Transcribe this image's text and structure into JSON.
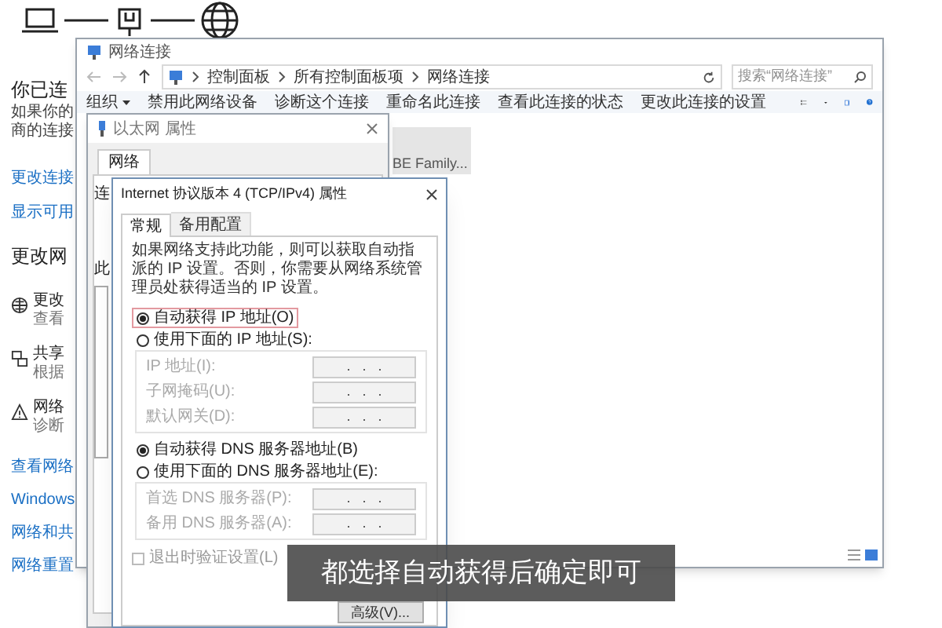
{
  "settings_page": {
    "heading": "你已连",
    "description_lines": [
      "如果你的",
      "商的连接"
    ],
    "links": [
      "更改连接",
      "显示可用"
    ],
    "section_heading": "更改网",
    "options": [
      {
        "kind": "status",
        "title": "更改",
        "subtitle": "查看"
      },
      {
        "kind": "sharing",
        "title": "共享",
        "subtitle": "根据"
      },
      {
        "kind": "troubleshoot",
        "title": "网络",
        "subtitle": "诊断"
      }
    ],
    "more_links": [
      "查看网络",
      "Windows",
      "网络和共",
      "网络重置"
    ]
  },
  "explorer_window": {
    "title": "网络连接",
    "breadcrumb": [
      "控制面板",
      "所有控制面板项",
      "网络连接"
    ],
    "search": {
      "placeholder": "搜索“网络连接”"
    },
    "organize": "组织",
    "toolbar": [
      "禁用此网络设备",
      "诊断这个连接",
      "重命名此连接",
      "查看此连接的状态",
      "更改此连接的设置"
    ],
    "adapter_label": "BE Family..."
  },
  "ethernet_properties": {
    "title": "以太网 属性",
    "tabs": [
      {
        "label": "网络",
        "selected": true
      }
    ],
    "partial_labels": [
      "连",
      "此"
    ]
  },
  "ipv4_properties": {
    "title": "Internet 协议版本 4 (TCP/IPv4) 属性",
    "tabs": [
      {
        "label": "常规",
        "selected": true
      },
      {
        "label": "备用配置",
        "selected": false
      }
    ],
    "description": "如果网络支持此功能，则可以获取自动指派的 IP 设置。否则，你需要从网络系统管理员处获得适当的 IP 设置。",
    "ip_mode": [
      {
        "label": "自动获得 IP 地址(O)",
        "selected": true,
        "highlighted": true
      },
      {
        "label": "使用下面的 IP 地址(S):",
        "selected": false,
        "highlighted": false
      }
    ],
    "ip_fields": [
      {
        "label": "IP 地址(I):",
        "value": ".   .   ."
      },
      {
        "label": "子网掩码(U):",
        "value": ".   .   ."
      },
      {
        "label": "默认网关(D):",
        "value": ".   .   ."
      }
    ],
    "dns_mode": [
      {
        "label": "自动获得 DNS 服务器地址(B)",
        "selected": true
      },
      {
        "label": "使用下面的 DNS 服务器地址(E):",
        "selected": false
      }
    ],
    "dns_fields": [
      {
        "label": "首选 DNS 服务器(P):",
        "value": ".   .   ."
      },
      {
        "label": "备用 DNS 服务器(A):",
        "value": ".   .   ."
      }
    ],
    "validate_checkbox": {
      "label": "退出时验证设置(L)",
      "checked": false
    },
    "advanced_button": "高级(V)..."
  },
  "subtitle": "都选择自动获得后确定即可"
}
